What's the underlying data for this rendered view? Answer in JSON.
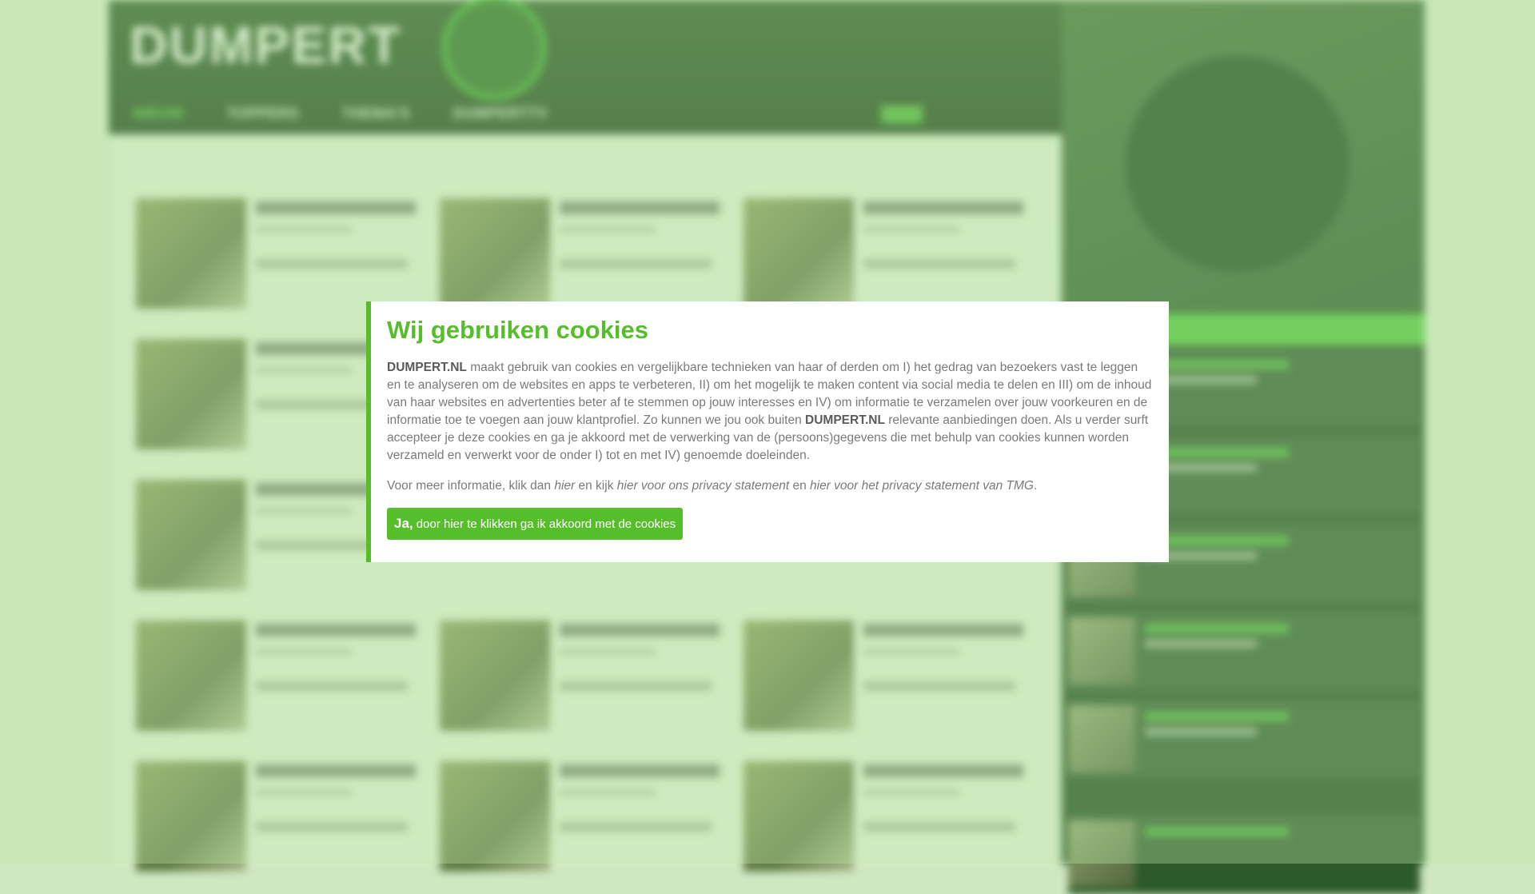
{
  "site": {
    "logo": "DUMPERT",
    "nav": [
      "NIEUW",
      "TOPPERS",
      "THEMA'S",
      "DUMPERTTV"
    ]
  },
  "cookie_modal": {
    "title": "Wij gebruiken cookies",
    "brand": "DUMPERT.NL",
    "para1_part1": " maakt gebruik van cookies en vergelijkbare technieken van haar of derden om I) het gedrag van bezoekers vast te leggen en te analyseren om de websites en apps te verbeteren, II) om het mogelijk te maken content via social media te delen en III) om de inhoud van haar websites en advertenties beter af te stemmen op jouw interesses en IV) om informatie te verzamelen over jouw voorkeuren en de informatie toe te voegen aan jouw klantprofiel. Zo kunnen we jou ook buiten ",
    "para1_part2": " relevante aanbiedingen doen. Als u verder surft accepteer je deze cookies en ga je akkoord met de verwerking van de (persoons)gegevens die met behulp van cookies kunnen worden verzameld en verwerkt voor de onder I) tot en met IV) genoemde doeleinden.",
    "para2_text1": "Voor meer informatie, klik dan ",
    "para2_link1": "hier",
    "para2_text2": " en kijk ",
    "para2_link2": "hier voor ons privacy statement",
    "para2_text3": " en ",
    "para2_link3": "hier voor het privacy statement van TMG",
    "para2_text4": ".",
    "accept_bold": "Ja,",
    "accept_rest": " door hier te klikken ga ik akkoord met de cookies"
  },
  "colors": {
    "accent": "#56bd2b",
    "text": "#7a7a7a"
  }
}
